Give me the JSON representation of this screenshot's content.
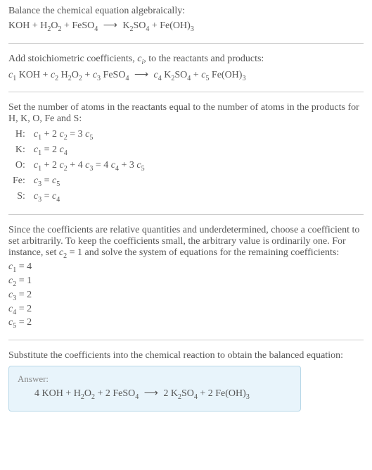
{
  "step1": {
    "intro": "Balance the chemical equation algebraically:",
    "lhs1": "KOH + H",
    "lhs2": "O",
    "lhs3": " + FeSO",
    "rhs1": "K",
    "rhs2": "SO",
    "rhs3": " + Fe(OH)"
  },
  "step2": {
    "intro_a": "Add stoichiometric coefficients, ",
    "ci": "c",
    "ci_sub": "i",
    "intro_b": ", to the reactants and products:",
    "t_koh": " KOH + ",
    "t_h2o2a": " H",
    "t_h2o2b": "O",
    "t_plus2": " + ",
    "t_feso4": " FeSO",
    "t_k2so4a": " K",
    "t_k2so4b": "SO",
    "t_plus3": " + ",
    "t_feoh3": " Fe(OH)",
    "c1": "c",
    "s1": "1",
    "c2": "c",
    "s2": "2",
    "c3": "c",
    "s3": "3",
    "c4": "c",
    "s4": "4",
    "c5": "c",
    "s5": "5"
  },
  "step3": {
    "intro": "Set the number of atoms in the reactants equal to the number of atoms in the products for H, K, O, Fe and S:",
    "rows": [
      {
        "el": "H:",
        "lhs_a": "c",
        "lhs_as": "1",
        "lhs_b": " + 2 ",
        "lhs_c": "c",
        "lhs_cs": "2",
        "rhs_a": " = 3 ",
        "rhs_b": "c",
        "rhs_bs": "5"
      },
      {
        "el": "K:",
        "lhs_a": "c",
        "lhs_as": "1",
        "lhs_b": "",
        "lhs_c": "",
        "lhs_cs": "",
        "rhs_a": " = 2 ",
        "rhs_b": "c",
        "rhs_bs": "4"
      },
      {
        "el": "O:",
        "lhs_a": "c",
        "lhs_as": "1",
        "lhs_b": " + 2 ",
        "lhs_c": "c",
        "lhs_cs": "2",
        "lhs_d": " + 4 ",
        "lhs_e": "c",
        "lhs_es": "3",
        "rhs_a": " = 4 ",
        "rhs_b": "c",
        "rhs_bs": "4",
        "rhs_c": " + 3 ",
        "rhs_d": "c",
        "rhs_ds": "5"
      },
      {
        "el": "Fe:",
        "lhs_a": "c",
        "lhs_as": "3",
        "lhs_b": "",
        "lhs_c": "",
        "lhs_cs": "",
        "rhs_a": " = ",
        "rhs_b": "c",
        "rhs_bs": "5"
      },
      {
        "el": "S:",
        "lhs_a": "c",
        "lhs_as": "3",
        "lhs_b": "",
        "lhs_c": "",
        "lhs_cs": "",
        "rhs_a": " = ",
        "rhs_b": "c",
        "rhs_bs": "4"
      }
    ]
  },
  "step4": {
    "intro_a": "Since the coefficients are relative quantities and underdetermined, choose a coefficient to set arbitrarily. To keep the coefficients small, the arbitrary value is ordinarily one. For instance, set ",
    "c2": "c",
    "c2s": "2",
    "intro_b": " = 1 and solve the system of equations for the remaining coefficients:",
    "sol": [
      {
        "c": "c",
        "s": "1",
        "v": " = 4"
      },
      {
        "c": "c",
        "s": "2",
        "v": " = 1"
      },
      {
        "c": "c",
        "s": "3",
        "v": " = 2"
      },
      {
        "c": "c",
        "s": "4",
        "v": " = 2"
      },
      {
        "c": "c",
        "s": "5",
        "v": " = 2"
      }
    ]
  },
  "step5": {
    "intro": "Substitute the coefficients into the chemical reaction to obtain the balanced equation:",
    "answer_label": "Answer:",
    "eq_a": "4 KOH + H",
    "eq_b": "O",
    "eq_c": " + 2 FeSO",
    "eq_d": "2 K",
    "eq_e": "SO",
    "eq_f": " + 2 Fe(OH)"
  },
  "subs": {
    "two": "2",
    "three": "3",
    "four": "4"
  },
  "arrow": "⟶"
}
